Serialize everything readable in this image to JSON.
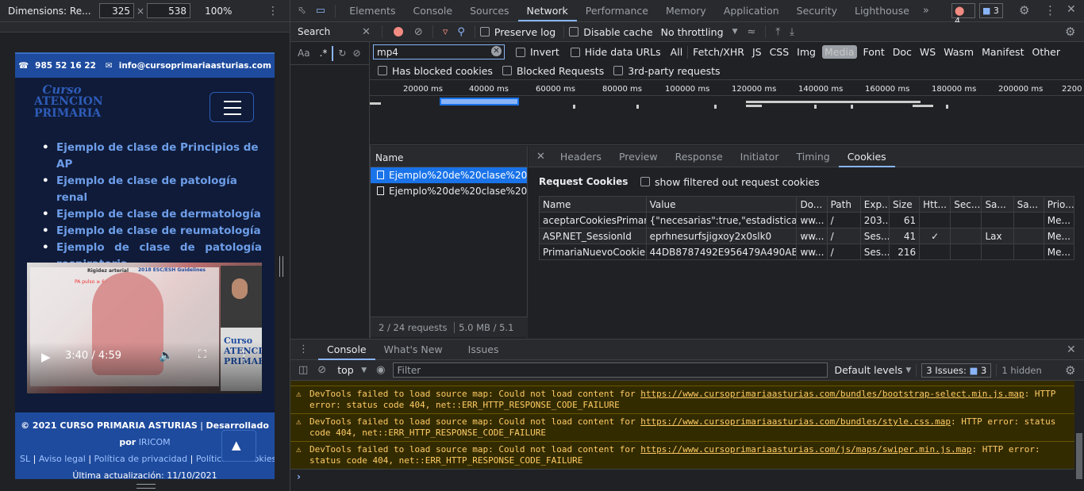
{
  "device_toolbar": {
    "dimensions_label": "Dimensions: Re...",
    "width": "325",
    "times": "×",
    "height": "538",
    "zoom": "100%"
  },
  "site": {
    "phone": "985 52 16 22",
    "email": "info@cursoprimariaasturias.com",
    "logo_lines": [
      "Curso",
      "ATENCION",
      "PRIMARIA"
    ],
    "list_items": [
      "Ejemplo de clase de Principios de AP",
      "Ejemplo de clase de patología renal",
      "Ejemplo de clase de dermatología",
      "Ejemplo de clase de reumatología",
      "Ejemplo de clase de patología respiratoria"
    ],
    "video_time": "3:40 / 4:59",
    "video_overlay_title": "Rigidez arterial",
    "video_overlay_guidelines": "2018 ESC/ESH Guidelines",
    "video_overlay_pulse": "PA pulso ≥ 60",
    "footer_line1_a": "© 2021 CURSO PRIMARIA ASTURIAS",
    "footer_line1_b": "Desarrollado por",
    "footer_line1_link": "IRICOM",
    "footer_line2_a": "SL",
    "footer_aviso": "Aviso legal",
    "footer_privacidad": "Política de privacidad",
    "footer_cookies": "Política de cookies",
    "footer_update": "Última actualización: 11/10/2021"
  },
  "devtools": {
    "tabs": [
      "Elements",
      "Console",
      "Sources",
      "Network",
      "Performance",
      "Memory",
      "Application",
      "Security",
      "Lighthouse"
    ],
    "more": "»",
    "errors_count": "4",
    "messages_count": "3",
    "search_label": "Search",
    "preserve_log": "Preserve log",
    "disable_cache": "Disable cache",
    "throttling": "No throttling",
    "filter_value": "mp4",
    "invert": "Invert",
    "hide_data_urls": "Hide data URLs",
    "filter_types": [
      "All",
      "Fetch/XHR",
      "JS",
      "CSS",
      "Img",
      "Media",
      "Font",
      "Doc",
      "WS",
      "Wasm",
      "Manifest",
      "Other"
    ],
    "active_type": "Media",
    "has_blocked_cookies": "Has blocked cookies",
    "blocked_requests": "Blocked Requests",
    "third_party": "3rd-party requests",
    "timeline_ticks": [
      "20000 ms",
      "40000 ms",
      "60000 ms",
      "80000 ms",
      "100000 ms",
      "120000 ms",
      "140000 ms",
      "160000 ms",
      "180000 ms",
      "200000 ms",
      "2200"
    ],
    "search_aa": "Aa",
    "search_regex": ".*",
    "name_header": "Name",
    "requests": [
      "Ejemplo%20de%20clase%20d...",
      "Ejemplo%20de%20clase%20d..."
    ],
    "status_requests": "2 / 24 requests",
    "status_size": "5.0 MB / 5.1 MB",
    "detail_tabs": [
      "Headers",
      "Preview",
      "Response",
      "Initiator",
      "Timing",
      "Cookies"
    ],
    "active_detail_tab": "Cookies",
    "request_cookies_title": "Request Cookies",
    "show_filtered": "show filtered out request cookies",
    "cookie_columns": [
      "Name",
      "Value",
      "Do...",
      "Path",
      "Exp...",
      "Size",
      "Htt...",
      "Sec...",
      "Sa...",
      "Sa...",
      "Prio..."
    ],
    "cookie_rows": [
      [
        "aceptarCookiesPrimaria",
        "{\"necesarias\":true,\"estadisticas\":t...",
        "ww...",
        "/",
        "203...",
        "61",
        "",
        "",
        "",
        "",
        "Me..."
      ],
      [
        "ASP.NET_SessionId",
        "eprhnesurfsjigxoy2x0slk0",
        "ww...",
        "/",
        "Ses...",
        "41",
        "✓",
        "",
        "Lax",
        "",
        "Me..."
      ],
      [
        "PrimariaNuevoCookie...",
        "44DB8787492E956479A490AB1...",
        "ww...",
        "/",
        "Ses...",
        "216",
        "",
        "",
        "",
        "",
        "Me..."
      ]
    ],
    "drawer_tabs": [
      "Console",
      "What's New",
      "Issues"
    ],
    "context": "top",
    "console_filter_placeholder": "Filter",
    "default_levels": "Default levels",
    "issues_label": "3 Issues:",
    "issues_count": "3",
    "hidden": "1 hidden",
    "console_messages": [
      {
        "pre": "DevTools failed to load source map: Could not load content for ",
        "url": "https://www.cursoprimariaasturias.com/bundles/bootstrap-select.min.js.map",
        "post": ": HTTP error: status code 404, net::ERR_HTTP_RESPONSE_CODE_FAILURE"
      },
      {
        "pre": "DevTools failed to load source map: Could not load content for ",
        "url": "https://www.cursoprimariaasturias.com/bundles/style.css.map",
        "post": ": HTTP error: status code 404, net::ERR_HTTP_RESPONSE_CODE_FAILURE"
      },
      {
        "pre": "DevTools failed to load source map: Could not load content for ",
        "url": "https://www.cursoprimariaasturias.com/js/maps/swiper.min.js.map",
        "post": ": HTTP error: status code 404, net::ERR_HTTP_RESPONSE_CODE_FAILURE"
      }
    ],
    "prompt": "›"
  }
}
